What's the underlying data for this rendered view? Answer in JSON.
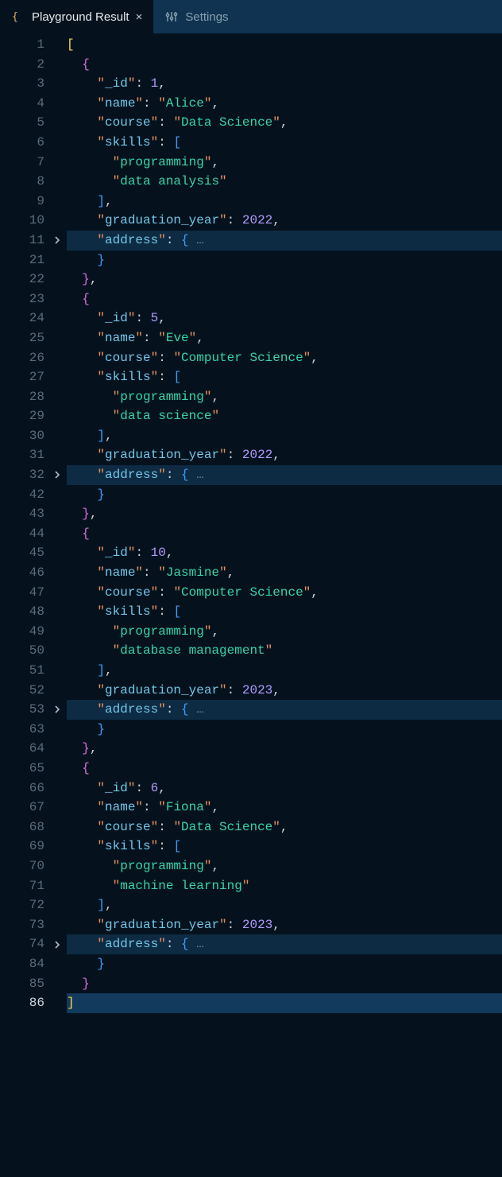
{
  "tabs": [
    {
      "label": "Playground Result",
      "active": true,
      "icon": "braces-icon",
      "closable": true
    },
    {
      "label": "Settings",
      "active": false,
      "icon": "settings-icon",
      "closable": false
    }
  ],
  "line_numbers": [
    "1",
    "2",
    "3",
    "4",
    "5",
    "6",
    "7",
    "8",
    "9",
    "10",
    "11",
    "21",
    "22",
    "23",
    "24",
    "25",
    "26",
    "27",
    "28",
    "29",
    "30",
    "31",
    "32",
    "42",
    "43",
    "44",
    "45",
    "46",
    "47",
    "48",
    "49",
    "50",
    "51",
    "52",
    "53",
    "63",
    "64",
    "65",
    "66",
    "67",
    "68",
    "69",
    "70",
    "71",
    "72",
    "73",
    "74",
    "84",
    "85",
    "86"
  ],
  "folds": {
    "11": true,
    "32": true,
    "53": true,
    "74": true
  },
  "highlights": [
    "11",
    "32",
    "53",
    "74"
  ],
  "cursor_line": "86",
  "code_lines": [
    {
      "ln": "1",
      "tokens": [
        [
          "br-y",
          "["
        ]
      ]
    },
    {
      "ln": "2",
      "tokens": [
        [
          "ind",
          "  "
        ],
        [
          "br-m",
          "{"
        ]
      ]
    },
    {
      "ln": "3",
      "tokens": [
        [
          "ind",
          "    "
        ],
        [
          "qt",
          "\""
        ],
        [
          "key",
          "_id"
        ],
        [
          "qt",
          "\""
        ],
        [
          "pn",
          ": "
        ],
        [
          "num",
          "1"
        ],
        [
          "pn",
          ","
        ]
      ]
    },
    {
      "ln": "4",
      "tokens": [
        [
          "ind",
          "    "
        ],
        [
          "qt",
          "\""
        ],
        [
          "key",
          "name"
        ],
        [
          "qt",
          "\""
        ],
        [
          "pn",
          ": "
        ],
        [
          "qt",
          "\""
        ],
        [
          "str",
          "Alice"
        ],
        [
          "qt",
          "\""
        ],
        [
          "pn",
          ","
        ]
      ]
    },
    {
      "ln": "5",
      "tokens": [
        [
          "ind",
          "    "
        ],
        [
          "qt",
          "\""
        ],
        [
          "key",
          "course"
        ],
        [
          "qt",
          "\""
        ],
        [
          "pn",
          ": "
        ],
        [
          "qt",
          "\""
        ],
        [
          "str",
          "Data Science"
        ],
        [
          "qt",
          "\""
        ],
        [
          "pn",
          ","
        ]
      ]
    },
    {
      "ln": "6",
      "tokens": [
        [
          "ind",
          "    "
        ],
        [
          "qt",
          "\""
        ],
        [
          "key",
          "skills"
        ],
        [
          "qt",
          "\""
        ],
        [
          "pn",
          ": "
        ],
        [
          "br-b",
          "["
        ]
      ]
    },
    {
      "ln": "7",
      "tokens": [
        [
          "ind",
          "      "
        ],
        [
          "qt",
          "\""
        ],
        [
          "str",
          "programming"
        ],
        [
          "qt",
          "\""
        ],
        [
          "pn",
          ","
        ]
      ]
    },
    {
      "ln": "8",
      "tokens": [
        [
          "ind",
          "      "
        ],
        [
          "qt",
          "\""
        ],
        [
          "str",
          "data analysis"
        ],
        [
          "qt",
          "\""
        ]
      ]
    },
    {
      "ln": "9",
      "tokens": [
        [
          "ind",
          "    "
        ],
        [
          "br-b",
          "]"
        ],
        [
          "pn",
          ","
        ]
      ]
    },
    {
      "ln": "10",
      "tokens": [
        [
          "ind",
          "    "
        ],
        [
          "qt",
          "\""
        ],
        [
          "key",
          "graduation_year"
        ],
        [
          "qt",
          "\""
        ],
        [
          "pn",
          ": "
        ],
        [
          "num",
          "2022"
        ],
        [
          "pn",
          ","
        ]
      ]
    },
    {
      "ln": "11",
      "tokens": [
        [
          "ind",
          "    "
        ],
        [
          "qt",
          "\""
        ],
        [
          "key",
          "address"
        ],
        [
          "qt",
          "\""
        ],
        [
          "pn",
          ": "
        ],
        [
          "br-b",
          "{"
        ],
        [
          "ell",
          " …"
        ]
      ]
    },
    {
      "ln": "21",
      "tokens": [
        [
          "ind",
          "    "
        ],
        [
          "br-b",
          "}"
        ]
      ]
    },
    {
      "ln": "22",
      "tokens": [
        [
          "ind",
          "  "
        ],
        [
          "br-m",
          "}"
        ],
        [
          "pn",
          ","
        ]
      ]
    },
    {
      "ln": "23",
      "tokens": [
        [
          "ind",
          "  "
        ],
        [
          "br-m",
          "{"
        ]
      ]
    },
    {
      "ln": "24",
      "tokens": [
        [
          "ind",
          "    "
        ],
        [
          "qt",
          "\""
        ],
        [
          "key",
          "_id"
        ],
        [
          "qt",
          "\""
        ],
        [
          "pn",
          ": "
        ],
        [
          "num",
          "5"
        ],
        [
          "pn",
          ","
        ]
      ]
    },
    {
      "ln": "25",
      "tokens": [
        [
          "ind",
          "    "
        ],
        [
          "qt",
          "\""
        ],
        [
          "key",
          "name"
        ],
        [
          "qt",
          "\""
        ],
        [
          "pn",
          ": "
        ],
        [
          "qt",
          "\""
        ],
        [
          "str",
          "Eve"
        ],
        [
          "qt",
          "\""
        ],
        [
          "pn",
          ","
        ]
      ]
    },
    {
      "ln": "26",
      "tokens": [
        [
          "ind",
          "    "
        ],
        [
          "qt",
          "\""
        ],
        [
          "key",
          "course"
        ],
        [
          "qt",
          "\""
        ],
        [
          "pn",
          ": "
        ],
        [
          "qt",
          "\""
        ],
        [
          "str",
          "Computer Science"
        ],
        [
          "qt",
          "\""
        ],
        [
          "pn",
          ","
        ]
      ]
    },
    {
      "ln": "27",
      "tokens": [
        [
          "ind",
          "    "
        ],
        [
          "qt",
          "\""
        ],
        [
          "key",
          "skills"
        ],
        [
          "qt",
          "\""
        ],
        [
          "pn",
          ": "
        ],
        [
          "br-b",
          "["
        ]
      ]
    },
    {
      "ln": "28",
      "tokens": [
        [
          "ind",
          "      "
        ],
        [
          "qt",
          "\""
        ],
        [
          "str",
          "programming"
        ],
        [
          "qt",
          "\""
        ],
        [
          "pn",
          ","
        ]
      ]
    },
    {
      "ln": "29",
      "tokens": [
        [
          "ind",
          "      "
        ],
        [
          "qt",
          "\""
        ],
        [
          "str",
          "data science"
        ],
        [
          "qt",
          "\""
        ]
      ]
    },
    {
      "ln": "30",
      "tokens": [
        [
          "ind",
          "    "
        ],
        [
          "br-b",
          "]"
        ],
        [
          "pn",
          ","
        ]
      ]
    },
    {
      "ln": "31",
      "tokens": [
        [
          "ind",
          "    "
        ],
        [
          "qt",
          "\""
        ],
        [
          "key",
          "graduation_year"
        ],
        [
          "qt",
          "\""
        ],
        [
          "pn",
          ": "
        ],
        [
          "num",
          "2022"
        ],
        [
          "pn",
          ","
        ]
      ]
    },
    {
      "ln": "32",
      "tokens": [
        [
          "ind",
          "    "
        ],
        [
          "qt",
          "\""
        ],
        [
          "key",
          "address"
        ],
        [
          "qt",
          "\""
        ],
        [
          "pn",
          ": "
        ],
        [
          "br-b",
          "{"
        ],
        [
          "ell",
          " …"
        ]
      ]
    },
    {
      "ln": "42",
      "tokens": [
        [
          "ind",
          "    "
        ],
        [
          "br-b",
          "}"
        ]
      ]
    },
    {
      "ln": "43",
      "tokens": [
        [
          "ind",
          "  "
        ],
        [
          "br-m",
          "}"
        ],
        [
          "pn",
          ","
        ]
      ]
    },
    {
      "ln": "44",
      "tokens": [
        [
          "ind",
          "  "
        ],
        [
          "br-m",
          "{"
        ]
      ]
    },
    {
      "ln": "45",
      "tokens": [
        [
          "ind",
          "    "
        ],
        [
          "qt",
          "\""
        ],
        [
          "key",
          "_id"
        ],
        [
          "qt",
          "\""
        ],
        [
          "pn",
          ": "
        ],
        [
          "num",
          "10"
        ],
        [
          "pn",
          ","
        ]
      ]
    },
    {
      "ln": "46",
      "tokens": [
        [
          "ind",
          "    "
        ],
        [
          "qt",
          "\""
        ],
        [
          "key",
          "name"
        ],
        [
          "qt",
          "\""
        ],
        [
          "pn",
          ": "
        ],
        [
          "qt",
          "\""
        ],
        [
          "str",
          "Jasmine"
        ],
        [
          "qt",
          "\""
        ],
        [
          "pn",
          ","
        ]
      ]
    },
    {
      "ln": "47",
      "tokens": [
        [
          "ind",
          "    "
        ],
        [
          "qt",
          "\""
        ],
        [
          "key",
          "course"
        ],
        [
          "qt",
          "\""
        ],
        [
          "pn",
          ": "
        ],
        [
          "qt",
          "\""
        ],
        [
          "str",
          "Computer Science"
        ],
        [
          "qt",
          "\""
        ],
        [
          "pn",
          ","
        ]
      ]
    },
    {
      "ln": "48",
      "tokens": [
        [
          "ind",
          "    "
        ],
        [
          "qt",
          "\""
        ],
        [
          "key",
          "skills"
        ],
        [
          "qt",
          "\""
        ],
        [
          "pn",
          ": "
        ],
        [
          "br-b",
          "["
        ]
      ]
    },
    {
      "ln": "49",
      "tokens": [
        [
          "ind",
          "      "
        ],
        [
          "qt",
          "\""
        ],
        [
          "str",
          "programming"
        ],
        [
          "qt",
          "\""
        ],
        [
          "pn",
          ","
        ]
      ]
    },
    {
      "ln": "50",
      "tokens": [
        [
          "ind",
          "      "
        ],
        [
          "qt",
          "\""
        ],
        [
          "str",
          "database management"
        ],
        [
          "qt",
          "\""
        ]
      ]
    },
    {
      "ln": "51",
      "tokens": [
        [
          "ind",
          "    "
        ],
        [
          "br-b",
          "]"
        ],
        [
          "pn",
          ","
        ]
      ]
    },
    {
      "ln": "52",
      "tokens": [
        [
          "ind",
          "    "
        ],
        [
          "qt",
          "\""
        ],
        [
          "key",
          "graduation_year"
        ],
        [
          "qt",
          "\""
        ],
        [
          "pn",
          ": "
        ],
        [
          "num",
          "2023"
        ],
        [
          "pn",
          ","
        ]
      ]
    },
    {
      "ln": "53",
      "tokens": [
        [
          "ind",
          "    "
        ],
        [
          "qt",
          "\""
        ],
        [
          "key",
          "address"
        ],
        [
          "qt",
          "\""
        ],
        [
          "pn",
          ": "
        ],
        [
          "br-b",
          "{"
        ],
        [
          "ell",
          " …"
        ]
      ]
    },
    {
      "ln": "63",
      "tokens": [
        [
          "ind",
          "    "
        ],
        [
          "br-b",
          "}"
        ]
      ]
    },
    {
      "ln": "64",
      "tokens": [
        [
          "ind",
          "  "
        ],
        [
          "br-m",
          "}"
        ],
        [
          "pn",
          ","
        ]
      ]
    },
    {
      "ln": "65",
      "tokens": [
        [
          "ind",
          "  "
        ],
        [
          "br-m",
          "{"
        ]
      ]
    },
    {
      "ln": "66",
      "tokens": [
        [
          "ind",
          "    "
        ],
        [
          "qt",
          "\""
        ],
        [
          "key",
          "_id"
        ],
        [
          "qt",
          "\""
        ],
        [
          "pn",
          ": "
        ],
        [
          "num",
          "6"
        ],
        [
          "pn",
          ","
        ]
      ]
    },
    {
      "ln": "67",
      "tokens": [
        [
          "ind",
          "    "
        ],
        [
          "qt",
          "\""
        ],
        [
          "key",
          "name"
        ],
        [
          "qt",
          "\""
        ],
        [
          "pn",
          ": "
        ],
        [
          "qt",
          "\""
        ],
        [
          "str",
          "Fiona"
        ],
        [
          "qt",
          "\""
        ],
        [
          "pn",
          ","
        ]
      ]
    },
    {
      "ln": "68",
      "tokens": [
        [
          "ind",
          "    "
        ],
        [
          "qt",
          "\""
        ],
        [
          "key",
          "course"
        ],
        [
          "qt",
          "\""
        ],
        [
          "pn",
          ": "
        ],
        [
          "qt",
          "\""
        ],
        [
          "str",
          "Data Science"
        ],
        [
          "qt",
          "\""
        ],
        [
          "pn",
          ","
        ]
      ]
    },
    {
      "ln": "69",
      "tokens": [
        [
          "ind",
          "    "
        ],
        [
          "qt",
          "\""
        ],
        [
          "key",
          "skills"
        ],
        [
          "qt",
          "\""
        ],
        [
          "pn",
          ": "
        ],
        [
          "br-b",
          "["
        ]
      ]
    },
    {
      "ln": "70",
      "tokens": [
        [
          "ind",
          "      "
        ],
        [
          "qt",
          "\""
        ],
        [
          "str",
          "programming"
        ],
        [
          "qt",
          "\""
        ],
        [
          "pn",
          ","
        ]
      ]
    },
    {
      "ln": "71",
      "tokens": [
        [
          "ind",
          "      "
        ],
        [
          "qt",
          "\""
        ],
        [
          "str",
          "machine learning"
        ],
        [
          "qt",
          "\""
        ]
      ]
    },
    {
      "ln": "72",
      "tokens": [
        [
          "ind",
          "    "
        ],
        [
          "br-b",
          "]"
        ],
        [
          "pn",
          ","
        ]
      ]
    },
    {
      "ln": "73",
      "tokens": [
        [
          "ind",
          "    "
        ],
        [
          "qt",
          "\""
        ],
        [
          "key",
          "graduation_year"
        ],
        [
          "qt",
          "\""
        ],
        [
          "pn",
          ": "
        ],
        [
          "num",
          "2023"
        ],
        [
          "pn",
          ","
        ]
      ]
    },
    {
      "ln": "74",
      "tokens": [
        [
          "ind",
          "    "
        ],
        [
          "qt",
          "\""
        ],
        [
          "key",
          "address"
        ],
        [
          "qt",
          "\""
        ],
        [
          "pn",
          ": "
        ],
        [
          "br-b",
          "{"
        ],
        [
          "ell",
          " …"
        ]
      ]
    },
    {
      "ln": "84",
      "tokens": [
        [
          "ind",
          "    "
        ],
        [
          "br-b",
          "}"
        ]
      ]
    },
    {
      "ln": "85",
      "tokens": [
        [
          "ind",
          "  "
        ],
        [
          "br-m",
          "}"
        ]
      ]
    },
    {
      "ln": "86",
      "tokens": [
        [
          "br-y",
          "]"
        ]
      ]
    }
  ]
}
